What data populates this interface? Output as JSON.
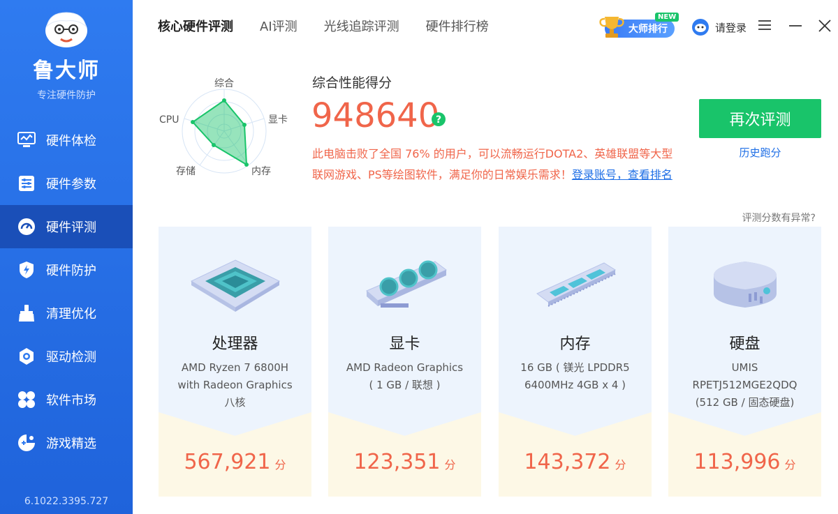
{
  "sidebar": {
    "brand": "鲁大师",
    "slogan": "专注硬件防护",
    "version": "6.1022.3395.727",
    "items": [
      {
        "label": "硬件体检",
        "icon": "monitor-check-icon"
      },
      {
        "label": "硬件参数",
        "icon": "params-list-icon"
      },
      {
        "label": "硬件评测",
        "icon": "speedometer-icon",
        "active": true
      },
      {
        "label": "硬件防护",
        "icon": "shield-bolt-icon"
      },
      {
        "label": "清理优化",
        "icon": "broom-icon"
      },
      {
        "label": "驱动检测",
        "icon": "gear-icon"
      },
      {
        "label": "软件市场",
        "icon": "apps-grid-icon"
      },
      {
        "label": "游戏精选",
        "icon": "gamepad-icon"
      }
    ]
  },
  "header": {
    "tabs": [
      {
        "label": "核心硬件评测",
        "active": true
      },
      {
        "label": "AI评测"
      },
      {
        "label": "光线追踪评测"
      },
      {
        "label": "硬件排行榜"
      }
    ],
    "rank_label": "大师排行",
    "new_tag": "NEW",
    "login": "请登录"
  },
  "radar": {
    "labels": {
      "top": "综合",
      "right": "显卡",
      "bottom_right": "内存",
      "bottom_left": "存储",
      "left": "CPU"
    }
  },
  "score": {
    "title": "综合性能得分",
    "value": "948640",
    "desc": "此电脑击败了全国 76% 的用户，可以流畅运行DOTA2、英雄联盟等大型联网游戏、PS等绘图软件，满足你的日常娱乐需求！",
    "login_link": "登录账号，查看排名",
    "retest": "再次评测",
    "history": "历史跑分",
    "anomaly": "评测分数有异常?"
  },
  "cards": [
    {
      "title": "处理器",
      "spec1": "AMD Ryzen 7 6800H",
      "spec2": "with Radeon Graphics",
      "spec3": "八核",
      "score": "567,921",
      "unit": "分"
    },
    {
      "title": "显卡",
      "spec1": "AMD Radeon Graphics",
      "spec2": "( 1 GB / 联想 )",
      "spec3": "",
      "score": "123,351",
      "unit": "分"
    },
    {
      "title": "内存",
      "spec1": "16 GB ( 镁光 LPDDR5",
      "spec2": "6400MHz 4GB x 4 )",
      "spec3": "",
      "score": "143,372",
      "unit": "分"
    },
    {
      "title": "硬盘",
      "spec1": "UMIS",
      "spec2": "RPETJ512MGE2QDQ",
      "spec3": "(512 GB / 固态硬盘)",
      "score": "113,996",
      "unit": "分"
    }
  ],
  "colors": {
    "accent": "#1f63db",
    "score": "#f0654a",
    "green": "#19c46a"
  }
}
